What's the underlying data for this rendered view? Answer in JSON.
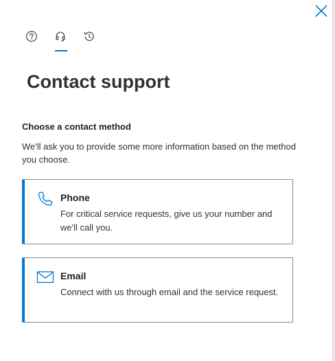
{
  "panel": {
    "title": "Contact support",
    "tabs": [
      {
        "icon": "help-icon",
        "active": false
      },
      {
        "icon": "headset-icon",
        "active": true
      },
      {
        "icon": "history-icon",
        "active": false
      }
    ]
  },
  "contact": {
    "heading": "Choose a contact method",
    "description": "We'll ask you to provide some more information based on the method you choose.",
    "methods": [
      {
        "icon": "phone-icon",
        "title": "Phone",
        "description": "For critical service requests, give us your number and we'll call you."
      },
      {
        "icon": "mail-icon",
        "title": "Email",
        "description": "Connect with us through email and the service request."
      }
    ]
  },
  "colors": {
    "accent": "#0078d4",
    "text": "#201f1e",
    "border": "#8a8886"
  }
}
